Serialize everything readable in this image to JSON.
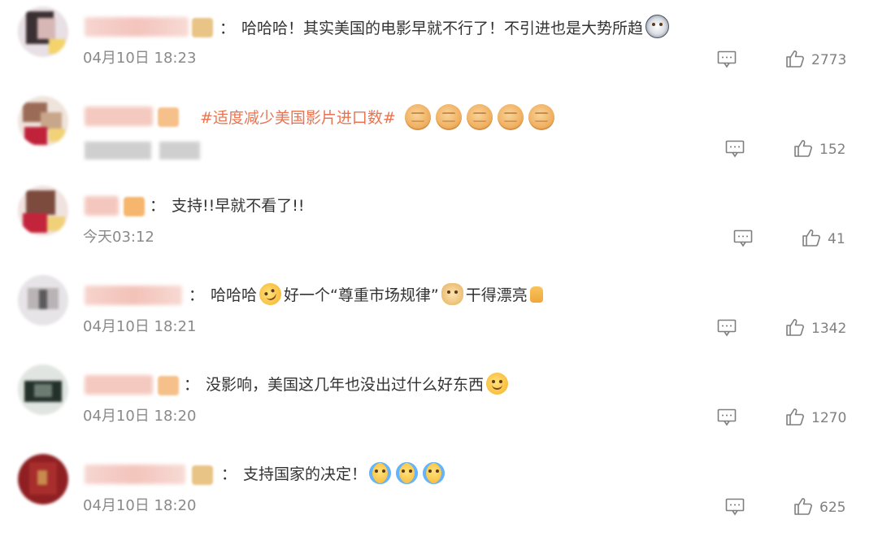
{
  "colors": {
    "text": "#333333",
    "meta": "#8a8a8a",
    "hashtag": "#eb7350",
    "icon": "#7f7f7f"
  },
  "comments": [
    {
      "avatar_icon": "blurred-avatar",
      "text": "哈哈哈！其实美国的电影早就不行了！不引进也是大势所趋",
      "emojis": [
        "husky-emoji"
      ],
      "time": "04月10日 18:23",
      "likes": "2773"
    },
    {
      "avatar_icon": "blurred-avatar",
      "hashtag": "#适度减少美国影片进口数#",
      "emojis": [
        "fist-emoji",
        "fist-emoji",
        "fist-emoji",
        "fist-emoji",
        "fist-emoji"
      ],
      "likes": "152"
    },
    {
      "avatar_icon": "blurred-avatar",
      "text": "支持!!早就不看了!!",
      "time": "今天03:12",
      "likes": "41"
    },
    {
      "avatar_icon": "blurred-avatar",
      "text_a": "哈哈哈",
      "text_b": "好一个“尊重市场规律”",
      "text_c": "干得漂亮",
      "emojis": [
        "rofl-emoji",
        "doge-emoji",
        "thumbs-up-emoji"
      ],
      "time": "04月10日 18:21",
      "likes": "1342"
    },
    {
      "avatar_icon": "blurred-avatar",
      "text": "没影响，美国这几年也没出过什么好东西",
      "emojis": [
        "yum-emoji"
      ],
      "time": "04月10日 18:20",
      "likes": "1270"
    },
    {
      "avatar_icon": "blurred-avatar",
      "text": "支持国家的决定！",
      "emojis": [
        "crying-emoji",
        "crying-emoji",
        "crying-emoji"
      ],
      "time": "04月10日 18:20",
      "likes": "625"
    }
  ],
  "punct": {
    "colon": "："
  }
}
